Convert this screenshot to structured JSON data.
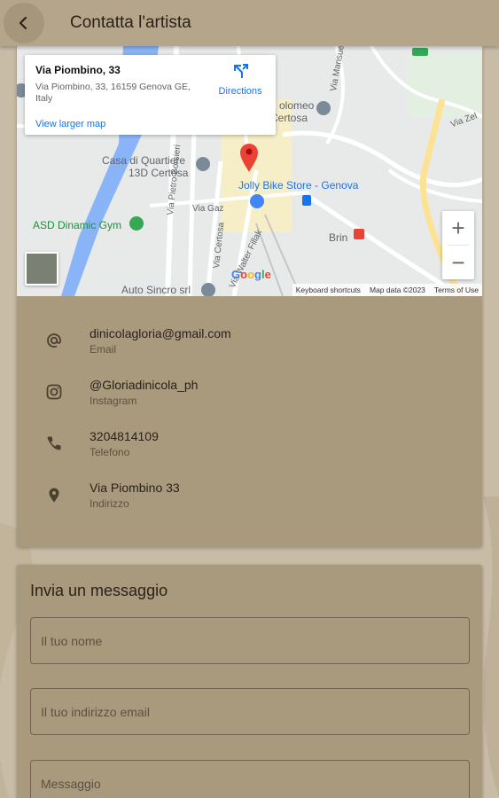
{
  "header": {
    "title": "Contatta l'artista"
  },
  "map": {
    "info": {
      "title": "Via Piombino, 33",
      "address": "Via Piombino, 33, 16159 Genova GE, Italy",
      "directions_label": "Directions",
      "larger_map_label": "View larger map"
    },
    "places": {
      "casa_line1": "Casa di Quartiere",
      "casa_line2": "13D Certosa",
      "bartolomeo_line1": "olomeo",
      "bartolomeo_line2": "Certosa",
      "jolly": "Jolly Bike Store - Genova",
      "asd": "ASD Dinamic Gym",
      "brin": "Brin",
      "auto": "Auto Sincro srl",
      "via_gaz": "Via Gaz",
      "via_borsieri": "Via Pietro Borsieri",
      "via_certosa": "Via Certosa",
      "via_fillak": "Via Walter Fillak",
      "via_mansueto": "Via Mansueto",
      "via_zel": "Via Zel"
    },
    "google": "Google",
    "footer": {
      "shortcuts": "Keyboard shortcuts",
      "mapdata": "Map data ©2023",
      "terms": "Terms of Use"
    },
    "zoom_in": "+",
    "zoom_out": "−"
  },
  "contacts": [
    {
      "icon": "at-icon",
      "value": "dinicolagloria@gmail.com",
      "label": "Email"
    },
    {
      "icon": "instagram-icon",
      "value": "@Gloriadinicola_ph",
      "label": "Instagram"
    },
    {
      "icon": "phone-icon",
      "value": "3204814109",
      "label": "Telefono"
    },
    {
      "icon": "location-pin-icon",
      "value": "Via Piombino 33",
      "label": "Indirizzo"
    }
  ],
  "form": {
    "title": "Invia un messaggio",
    "name_placeholder": "Il tuo nome",
    "email_placeholder": "Il tuo indirizzo email",
    "message_placeholder": "Messaggio"
  },
  "colors": {
    "appbar": "#b5a58b",
    "card": "#a99a7e",
    "background": "#c9bca6",
    "pin": "#ea4335",
    "link": "#1a73e8"
  }
}
